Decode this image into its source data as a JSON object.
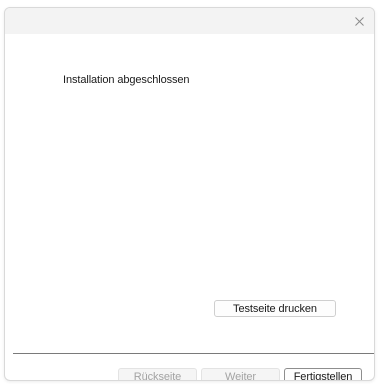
{
  "dialog": {
    "status_text": "Installation abgeschlossen",
    "close_icon": "close-icon",
    "test_print_label": "Testseite drucken"
  },
  "footer": {
    "back_label": "Rückseite",
    "next_label": "Weiter",
    "finish_label": "Fertigstellen"
  },
  "colors": {
    "titlebar": "#f3f3f3",
    "divider": "#7a7a7a",
    "disabled_text": "#a3a3a3"
  }
}
